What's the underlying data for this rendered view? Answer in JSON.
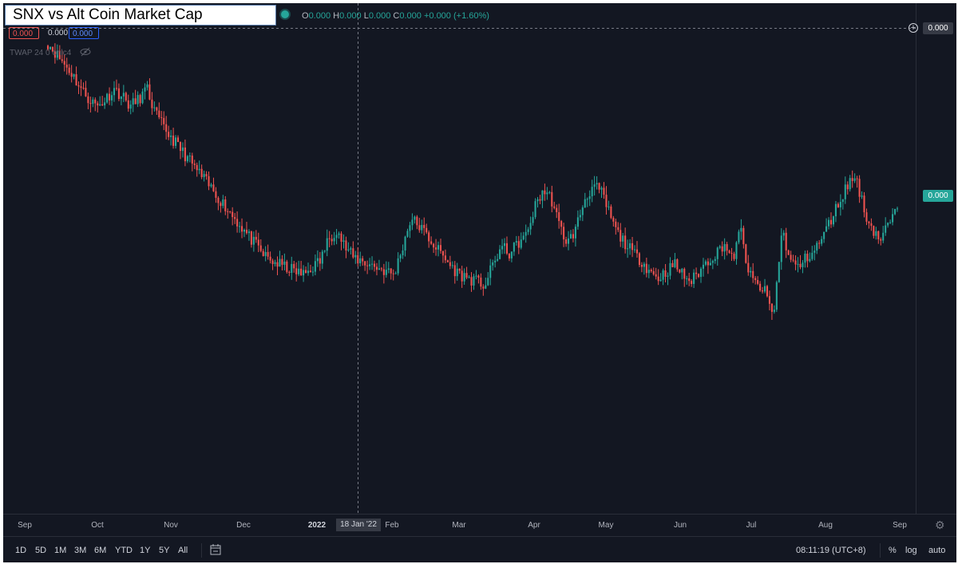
{
  "header": {
    "title": "SNX vs Alt Coin Market Cap",
    "ohlc": {
      "o_label": "O",
      "o_value": "0.000",
      "h_label": "H",
      "h_value": "0.000",
      "l_label": "L",
      "l_value": "0.000",
      "c_label": "C",
      "c_value": "0.000",
      "change": "+0.000 (+1.60%)"
    },
    "bid": "0.000",
    "spread": "0.000",
    "ask": "0.000",
    "indicator": "TWAP 24 0 ohlc4"
  },
  "price_scale": {
    "crosshair_value": "0.000",
    "last_value": "0.000"
  },
  "time_scale": {
    "crosshair_date": "18 Jan '22"
  },
  "bottom_bar": {
    "ranges": [
      "1D",
      "5D",
      "1M",
      "3M",
      "6M",
      "YTD",
      "1Y",
      "5Y",
      "All"
    ],
    "clock": "08:11:19 (UTC+8)",
    "options": [
      "%",
      "log",
      "auto"
    ]
  },
  "colors": {
    "up": "#26a69a",
    "down": "#ef5350",
    "background": "#131722"
  },
  "chart_data": {
    "type": "candlestick",
    "title": "SNX vs Alt Coin Market Cap",
    "x_ticks": [
      "Sep",
      "Oct",
      "Nov",
      "Dec",
      "2022",
      "Feb",
      "Mar",
      "Apr",
      "May",
      "Jun",
      "Jul",
      "Aug",
      "Sep"
    ],
    "y_tick_labels": [],
    "grid": false,
    "series": [
      {
        "name": "",
        "values": [
          1.0,
          0.97,
          0.94,
          0.91,
          0.87,
          0.84,
          0.82,
          0.84,
          0.87,
          0.85,
          0.82,
          0.84,
          0.87,
          0.8,
          0.76,
          0.73,
          0.7,
          0.67,
          0.64,
          0.61,
          0.58,
          0.55,
          0.52,
          0.49,
          0.46,
          0.43,
          0.4,
          0.38,
          0.37,
          0.36,
          0.35,
          0.34,
          0.36,
          0.38,
          0.44,
          0.47,
          0.42,
          0.39,
          0.38,
          0.37,
          0.36,
          0.35,
          0.34,
          0.42,
          0.5,
          0.48,
          0.45,
          0.42,
          0.39,
          0.36,
          0.34,
          0.33,
          0.32,
          0.31,
          0.37,
          0.42,
          0.4,
          0.43,
          0.45,
          0.53,
          0.58,
          0.56,
          0.48,
          0.43,
          0.47,
          0.55,
          0.59,
          0.58,
          0.52,
          0.46,
          0.43,
          0.4,
          0.38,
          0.35,
          0.33,
          0.35,
          0.37,
          0.34,
          0.32,
          0.35,
          0.38,
          0.4,
          0.43,
          0.38,
          0.47,
          0.34,
          0.31,
          0.29,
          0.22,
          0.47,
          0.38,
          0.36,
          0.39,
          0.41,
          0.45,
          0.5,
          0.55,
          0.6,
          0.62,
          0.52,
          0.47,
          0.44,
          0.49,
          0.52
        ]
      }
    ]
  }
}
